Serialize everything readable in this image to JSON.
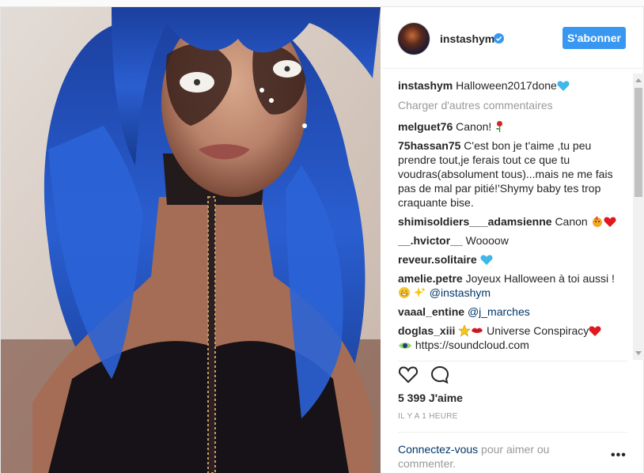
{
  "post": {
    "username": "instashym",
    "follow_label": "S'abonner",
    "caption": {
      "user": "instashym",
      "text": "Halloween2017done"
    },
    "load_more": "Charger d'autres commentaires",
    "comments": [
      {
        "user": "melguet76",
        "text": "Canon! ",
        "emoji": "rose"
      },
      {
        "user": "75hassan75",
        "text": "C'est bon je t'aime ,tu peu prendre tout,je ferais tout ce que tu voudras(absolument tous)...mais ne me fais pas de mal par pitié!'Shymy baby tes trop craquante bise."
      },
      {
        "user": "shimisoldiers___adamsienne",
        "text": "Canon "
      },
      {
        "user": "__.hvictor__",
        "text": "Woooow"
      },
      {
        "user": "reveur.solitaire",
        "text": ""
      },
      {
        "user": "amelie.petre",
        "text": "Joyeux Halloween à toi aussi ! ",
        "mention": "@instashym"
      },
      {
        "user": "vaaal_entine",
        "text": "",
        "mention": "@j_marches"
      },
      {
        "user": "doglas_xiii",
        "text": "Universe Conspiracy",
        "link": "https://soundcloud.com"
      }
    ],
    "likes": "5 399 J'aime",
    "time": "IL Y A 1 HEURE",
    "login_link": "Connectez-vous",
    "login_rest": " pour aimer ou commenter.",
    "more": "•••"
  },
  "colors": {
    "accent": "#3897f0",
    "link": "#003569",
    "muted": "#999999",
    "wig": "#1f4fb8"
  },
  "icons": [
    "verified-badge-icon",
    "heart-icon",
    "comment-icon",
    "more-options-icon"
  ]
}
